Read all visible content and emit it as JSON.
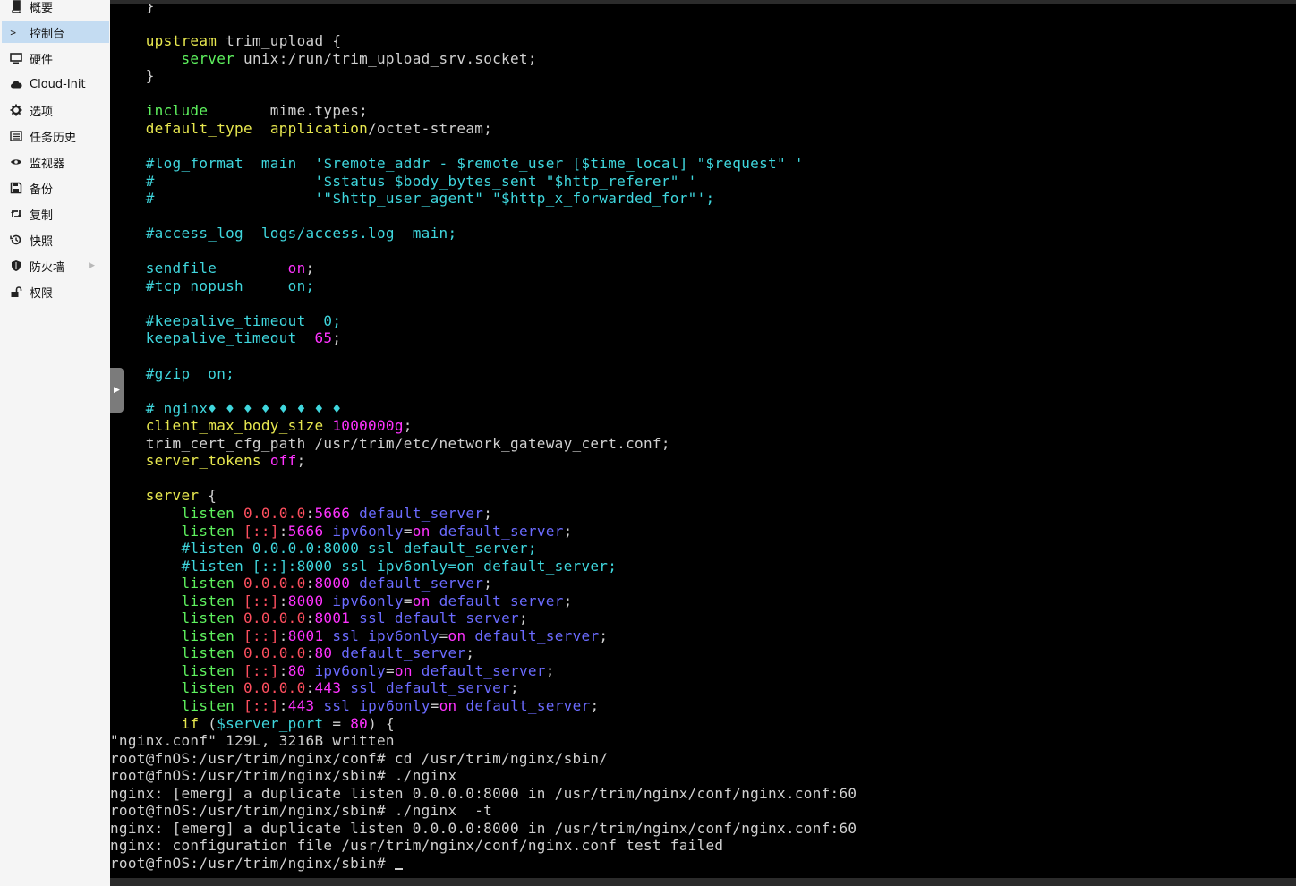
{
  "sidebar": {
    "items": [
      {
        "label": "概要",
        "icon": "book-icon"
      },
      {
        "label": "控制台",
        "icon": "terminal-icon",
        "active": true
      },
      {
        "label": "硬件",
        "icon": "monitor-icon"
      },
      {
        "label": "Cloud-Init",
        "icon": "cloud-icon"
      },
      {
        "label": "选项",
        "icon": "gear-icon"
      },
      {
        "label": "任务历史",
        "icon": "list-icon"
      },
      {
        "label": "监视器",
        "icon": "eye-icon"
      },
      {
        "label": "备份",
        "icon": "floppy-icon"
      },
      {
        "label": "复制",
        "icon": "retweet-icon"
      },
      {
        "label": "快照",
        "icon": "history-icon"
      },
      {
        "label": "防火墙",
        "icon": "shield-icon",
        "has_submenu": true
      },
      {
        "label": "权限",
        "icon": "unlock-icon"
      }
    ]
  },
  "colors": {
    "terminal_bg": "#000000",
    "keyword_yellow": "#e8e84f",
    "keyword_green": "#5ef25e",
    "comment_cyan": "#3fd6dd",
    "value_magenta": "#ff33ff",
    "ip_red": "#ff4f5f",
    "flag_blue": "#6b6bff",
    "active_nav": "#c4dcf2"
  },
  "terminal": {
    "lines": [
      {
        "indent": "    ",
        "spans": [
          {
            "t": "}",
            "c": "wh"
          }
        ]
      },
      {
        "indent": "",
        "spans": []
      },
      {
        "indent": "    ",
        "spans": [
          {
            "t": "upstream",
            "c": "kw-y"
          },
          {
            "t": " trim_upload {",
            "c": "wh"
          }
        ]
      },
      {
        "indent": "        ",
        "spans": [
          {
            "t": "server",
            "c": "kw-g"
          },
          {
            "t": " unix:/run/trim_upload_srv.socket;",
            "c": "wh"
          }
        ]
      },
      {
        "indent": "    ",
        "spans": [
          {
            "t": "}",
            "c": "wh"
          }
        ]
      },
      {
        "indent": "",
        "spans": []
      },
      {
        "indent": "    ",
        "spans": [
          {
            "t": "include",
            "c": "kw-g"
          },
          {
            "t": "       mime.types;",
            "c": "wh"
          }
        ]
      },
      {
        "indent": "    ",
        "spans": [
          {
            "t": "default_type",
            "c": "kw-y"
          },
          {
            "t": "  ",
            "c": "wh"
          },
          {
            "t": "application",
            "c": "kw-y"
          },
          {
            "t": "/octet-stream;",
            "c": "wh"
          }
        ]
      },
      {
        "indent": "",
        "spans": []
      },
      {
        "indent": "    ",
        "spans": [
          {
            "t": "#log_format  main  '$remote_addr - $remote_user [$time_local] \"$request\" '",
            "c": "cy"
          }
        ]
      },
      {
        "indent": "    ",
        "spans": [
          {
            "t": "#                  '$status $body_bytes_sent \"$http_referer\" '",
            "c": "cy"
          }
        ]
      },
      {
        "indent": "    ",
        "spans": [
          {
            "t": "#                  '\"$http_user_agent\" \"$http_x_forwarded_for\"';",
            "c": "cy"
          }
        ]
      },
      {
        "indent": "",
        "spans": []
      },
      {
        "indent": "    ",
        "spans": [
          {
            "t": "#access_log  logs/access.log  main;",
            "c": "cy"
          }
        ]
      },
      {
        "indent": "",
        "spans": []
      },
      {
        "indent": "    ",
        "spans": [
          {
            "t": "sendfile",
            "c": "cy"
          },
          {
            "t": "        ",
            "c": "wh"
          },
          {
            "t": "on",
            "c": "mg"
          },
          {
            "t": ";",
            "c": "wh"
          }
        ]
      },
      {
        "indent": "    ",
        "spans": [
          {
            "t": "#tcp_nopush     on;",
            "c": "cy"
          }
        ]
      },
      {
        "indent": "",
        "spans": []
      },
      {
        "indent": "    ",
        "spans": [
          {
            "t": "#keepalive_timeout  0;",
            "c": "cy"
          }
        ]
      },
      {
        "indent": "    ",
        "spans": [
          {
            "t": "keepalive_timeout",
            "c": "cy"
          },
          {
            "t": "  ",
            "c": "wh"
          },
          {
            "t": "65",
            "c": "mg"
          },
          {
            "t": ";",
            "c": "wh"
          }
        ]
      },
      {
        "indent": "",
        "spans": []
      },
      {
        "indent": "    ",
        "spans": [
          {
            "t": "#gzip  on;",
            "c": "cy"
          }
        ]
      },
      {
        "indent": "",
        "spans": []
      },
      {
        "indent": "    ",
        "spans": [
          {
            "t": "# nginx♦ ♦ ♦ ♦ ♦ ♦ ♦ ♦",
            "c": "cy"
          }
        ]
      },
      {
        "indent": "    ",
        "spans": [
          {
            "t": "client_max_body_size",
            "c": "kw-y"
          },
          {
            "t": " ",
            "c": "wh"
          },
          {
            "t": "1000000g",
            "c": "mg"
          },
          {
            "t": ";",
            "c": "wh"
          }
        ]
      },
      {
        "indent": "    ",
        "spans": [
          {
            "t": "trim_cert_cfg_path /usr/trim/etc/network_gateway_cert.conf;",
            "c": "wh"
          }
        ]
      },
      {
        "indent": "    ",
        "spans": [
          {
            "t": "server_tokens",
            "c": "kw-y"
          },
          {
            "t": " ",
            "c": "wh"
          },
          {
            "t": "off",
            "c": "mg"
          },
          {
            "t": ";",
            "c": "wh"
          }
        ]
      },
      {
        "indent": "",
        "spans": []
      },
      {
        "indent": "    ",
        "spans": [
          {
            "t": "server",
            "c": "kw-y"
          },
          {
            "t": " {",
            "c": "wh"
          }
        ]
      },
      {
        "indent": "        ",
        "spans": [
          {
            "t": "listen",
            "c": "kw-g"
          },
          {
            "t": " ",
            "c": "wh"
          },
          {
            "t": "0.0.0.0",
            "c": "rd"
          },
          {
            "t": ":",
            "c": "wh"
          },
          {
            "t": "5666",
            "c": "mg"
          },
          {
            "t": " ",
            "c": "wh"
          },
          {
            "t": "default_server",
            "c": "bl"
          },
          {
            "t": ";",
            "c": "wh"
          }
        ]
      },
      {
        "indent": "        ",
        "spans": [
          {
            "t": "listen",
            "c": "kw-g"
          },
          {
            "t": " ",
            "c": "wh"
          },
          {
            "t": "[::]",
            "c": "rd"
          },
          {
            "t": ":",
            "c": "wh"
          },
          {
            "t": "5666",
            "c": "mg"
          },
          {
            "t": " ",
            "c": "wh"
          },
          {
            "t": "ipv6only",
            "c": "bl"
          },
          {
            "t": "=",
            "c": "wh"
          },
          {
            "t": "on",
            "c": "mg"
          },
          {
            "t": " ",
            "c": "wh"
          },
          {
            "t": "default_server",
            "c": "bl"
          },
          {
            "t": ";",
            "c": "wh"
          }
        ]
      },
      {
        "indent": "        ",
        "spans": [
          {
            "t": "#listen 0.0.0.0:8000 ssl default_server;",
            "c": "cy"
          }
        ]
      },
      {
        "indent": "        ",
        "spans": [
          {
            "t": "#listen [::]:8000 ssl ipv6only=on default_server;",
            "c": "cy"
          }
        ]
      },
      {
        "indent": "        ",
        "spans": [
          {
            "t": "listen",
            "c": "kw-g"
          },
          {
            "t": " ",
            "c": "wh"
          },
          {
            "t": "0.0.0.0",
            "c": "rd"
          },
          {
            "t": ":",
            "c": "wh"
          },
          {
            "t": "8000",
            "c": "mg"
          },
          {
            "t": " ",
            "c": "wh"
          },
          {
            "t": "default_server",
            "c": "bl"
          },
          {
            "t": ";",
            "c": "wh"
          }
        ]
      },
      {
        "indent": "        ",
        "spans": [
          {
            "t": "listen",
            "c": "kw-g"
          },
          {
            "t": " ",
            "c": "wh"
          },
          {
            "t": "[::]",
            "c": "rd"
          },
          {
            "t": ":",
            "c": "wh"
          },
          {
            "t": "8000",
            "c": "mg"
          },
          {
            "t": " ",
            "c": "wh"
          },
          {
            "t": "ipv6only",
            "c": "bl"
          },
          {
            "t": "=",
            "c": "wh"
          },
          {
            "t": "on",
            "c": "mg"
          },
          {
            "t": " ",
            "c": "wh"
          },
          {
            "t": "default_server",
            "c": "bl"
          },
          {
            "t": ";",
            "c": "wh"
          }
        ]
      },
      {
        "indent": "        ",
        "spans": [
          {
            "t": "listen",
            "c": "kw-g"
          },
          {
            "t": " ",
            "c": "wh"
          },
          {
            "t": "0.0.0.0",
            "c": "rd"
          },
          {
            "t": ":",
            "c": "wh"
          },
          {
            "t": "8001",
            "c": "mg"
          },
          {
            "t": " ",
            "c": "wh"
          },
          {
            "t": "ssl",
            "c": "bl"
          },
          {
            "t": " ",
            "c": "wh"
          },
          {
            "t": "default_server",
            "c": "bl"
          },
          {
            "t": ";",
            "c": "wh"
          }
        ]
      },
      {
        "indent": "        ",
        "spans": [
          {
            "t": "listen",
            "c": "kw-g"
          },
          {
            "t": " ",
            "c": "wh"
          },
          {
            "t": "[::]",
            "c": "rd"
          },
          {
            "t": ":",
            "c": "wh"
          },
          {
            "t": "8001",
            "c": "mg"
          },
          {
            "t": " ",
            "c": "wh"
          },
          {
            "t": "ssl",
            "c": "bl"
          },
          {
            "t": " ",
            "c": "wh"
          },
          {
            "t": "ipv6only",
            "c": "bl"
          },
          {
            "t": "=",
            "c": "wh"
          },
          {
            "t": "on",
            "c": "mg"
          },
          {
            "t": " ",
            "c": "wh"
          },
          {
            "t": "default_server",
            "c": "bl"
          },
          {
            "t": ";",
            "c": "wh"
          }
        ]
      },
      {
        "indent": "        ",
        "spans": [
          {
            "t": "listen",
            "c": "kw-g"
          },
          {
            "t": " ",
            "c": "wh"
          },
          {
            "t": "0.0.0.0",
            "c": "rd"
          },
          {
            "t": ":",
            "c": "wh"
          },
          {
            "t": "80",
            "c": "mg"
          },
          {
            "t": " ",
            "c": "wh"
          },
          {
            "t": "default_server",
            "c": "bl"
          },
          {
            "t": ";",
            "c": "wh"
          }
        ]
      },
      {
        "indent": "        ",
        "spans": [
          {
            "t": "listen",
            "c": "kw-g"
          },
          {
            "t": " ",
            "c": "wh"
          },
          {
            "t": "[::]",
            "c": "rd"
          },
          {
            "t": ":",
            "c": "wh"
          },
          {
            "t": "80",
            "c": "mg"
          },
          {
            "t": " ",
            "c": "wh"
          },
          {
            "t": "ipv6only",
            "c": "bl"
          },
          {
            "t": "=",
            "c": "wh"
          },
          {
            "t": "on",
            "c": "mg"
          },
          {
            "t": " ",
            "c": "wh"
          },
          {
            "t": "default_server",
            "c": "bl"
          },
          {
            "t": ";",
            "c": "wh"
          }
        ]
      },
      {
        "indent": "        ",
        "spans": [
          {
            "t": "listen",
            "c": "kw-g"
          },
          {
            "t": " ",
            "c": "wh"
          },
          {
            "t": "0.0.0.0",
            "c": "rd"
          },
          {
            "t": ":",
            "c": "wh"
          },
          {
            "t": "443",
            "c": "mg"
          },
          {
            "t": " ",
            "c": "wh"
          },
          {
            "t": "ssl",
            "c": "bl"
          },
          {
            "t": " ",
            "c": "wh"
          },
          {
            "t": "default_server",
            "c": "bl"
          },
          {
            "t": ";",
            "c": "wh"
          }
        ]
      },
      {
        "indent": "        ",
        "spans": [
          {
            "t": "listen",
            "c": "kw-g"
          },
          {
            "t": " ",
            "c": "wh"
          },
          {
            "t": "[::]",
            "c": "rd"
          },
          {
            "t": ":",
            "c": "wh"
          },
          {
            "t": "443",
            "c": "mg"
          },
          {
            "t": " ",
            "c": "wh"
          },
          {
            "t": "ssl",
            "c": "bl"
          },
          {
            "t": " ",
            "c": "wh"
          },
          {
            "t": "ipv6only",
            "c": "bl"
          },
          {
            "t": "=",
            "c": "wh"
          },
          {
            "t": "on",
            "c": "mg"
          },
          {
            "t": " ",
            "c": "wh"
          },
          {
            "t": "default_server",
            "c": "bl"
          },
          {
            "t": ";",
            "c": "wh"
          }
        ]
      },
      {
        "indent": "        ",
        "spans": [
          {
            "t": "if",
            "c": "kw-y"
          },
          {
            "t": " (",
            "c": "wh"
          },
          {
            "t": "$server_port",
            "c": "cy"
          },
          {
            "t": " = ",
            "c": "wh"
          },
          {
            "t": "80",
            "c": "mg"
          },
          {
            "t": ") {",
            "c": "wh"
          }
        ]
      },
      {
        "indent": "",
        "spans": [
          {
            "t": "\"nginx.conf\" 129L, 3216B written",
            "c": "wh"
          }
        ]
      },
      {
        "indent": "",
        "spans": [
          {
            "t": "root@fnOS:/usr/trim/nginx/conf# cd /usr/trim/nginx/sbin/",
            "c": "wh"
          }
        ]
      },
      {
        "indent": "",
        "spans": [
          {
            "t": "root@fnOS:/usr/trim/nginx/sbin# ./nginx",
            "c": "wh"
          }
        ]
      },
      {
        "indent": "",
        "spans": [
          {
            "t": "nginx: [emerg] a duplicate listen 0.0.0.0:8000 in /usr/trim/nginx/conf/nginx.conf:60",
            "c": "wh"
          }
        ]
      },
      {
        "indent": "",
        "spans": [
          {
            "t": "root@fnOS:/usr/trim/nginx/sbin# ./nginx  -t",
            "c": "wh"
          }
        ]
      },
      {
        "indent": "",
        "spans": [
          {
            "t": "nginx: [emerg] a duplicate listen 0.0.0.0:8000 in /usr/trim/nginx/conf/nginx.conf:60",
            "c": "wh"
          }
        ]
      },
      {
        "indent": "",
        "spans": [
          {
            "t": "nginx: configuration file /usr/trim/nginx/conf/nginx.conf test failed",
            "c": "wh"
          }
        ]
      },
      {
        "indent": "",
        "spans": [
          {
            "t": "root@fnOS:/usr/trim/nginx/sbin# ",
            "c": "wh"
          }
        ],
        "cursor": true
      }
    ]
  }
}
